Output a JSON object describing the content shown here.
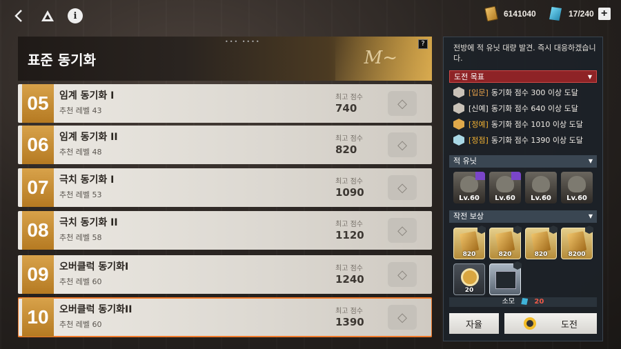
{
  "topbar": {
    "gold_amount": "6141040",
    "stamina": "17/240",
    "plus_label": "+"
  },
  "header": {
    "title": "표준 동기화",
    "help_label": "?"
  },
  "rows": [
    {
      "num": "05",
      "name": "임계 동기화 I",
      "level": "추천 레벨 43",
      "score_label": "최고 점수",
      "score": "740"
    },
    {
      "num": "06",
      "name": "임계 동기화 II",
      "level": "추천 레벨 48",
      "score_label": "최고 점수",
      "score": "820"
    },
    {
      "num": "07",
      "name": "극치 동기화 I",
      "level": "추천 레벨 53",
      "score_label": "최고 점수",
      "score": "1090"
    },
    {
      "num": "08",
      "name": "극치 동기화 II",
      "level": "추천 레벨 58",
      "score_label": "최고 점수",
      "score": "1120"
    },
    {
      "num": "09",
      "name": "오버클럭 동기화I",
      "level": "추천 레벨 60",
      "score_label": "최고 점수",
      "score": "1240"
    },
    {
      "num": "10",
      "name": "오버클럭 동기화II",
      "level": "추천 레벨 60",
      "score_label": "최고 점수",
      "score": "1390"
    }
  ],
  "panel": {
    "description": "전방에 적 유닛 대량 발견. 즉시 대응하겠습니다.",
    "goals_header": "도전 목표",
    "goals": [
      {
        "tag": "[입문]",
        "text": "동기화 점수 300 이상 도달",
        "tag_color": "#e8a24a",
        "icon_color": "#c9c2b8"
      },
      {
        "tag": "[신예]",
        "text": "동기화 점수 640 이상 도달",
        "tag_color": "#f0ece6",
        "icon_color": "#c9c2b8"
      },
      {
        "tag": "[정예]",
        "text": "동기화 점수 1010 이상 도달",
        "tag_color": "#f2b233",
        "icon_color": "#e0a94a"
      },
      {
        "tag": "[정점]",
        "text": "동기화 점수 1390 이상 도달",
        "tag_color": "#f2b233",
        "icon_color": "#a9d8e6"
      }
    ],
    "enemy_header": "적 유닛",
    "enemies": [
      {
        "level": "Lv.60"
      },
      {
        "level": "Lv.60"
      },
      {
        "level": "Lv.60"
      },
      {
        "level": "Lv.60"
      }
    ],
    "reward_header": "작전 보상",
    "rewards": [
      {
        "value": "820"
      },
      {
        "value": "820"
      },
      {
        "value": "820"
      },
      {
        "value": "8200"
      },
      {
        "value": "20"
      },
      {
        "value": ""
      }
    ],
    "cost_label": "소모",
    "cost_value": "20",
    "auto_label": "자율",
    "challenge_label": "도전"
  }
}
